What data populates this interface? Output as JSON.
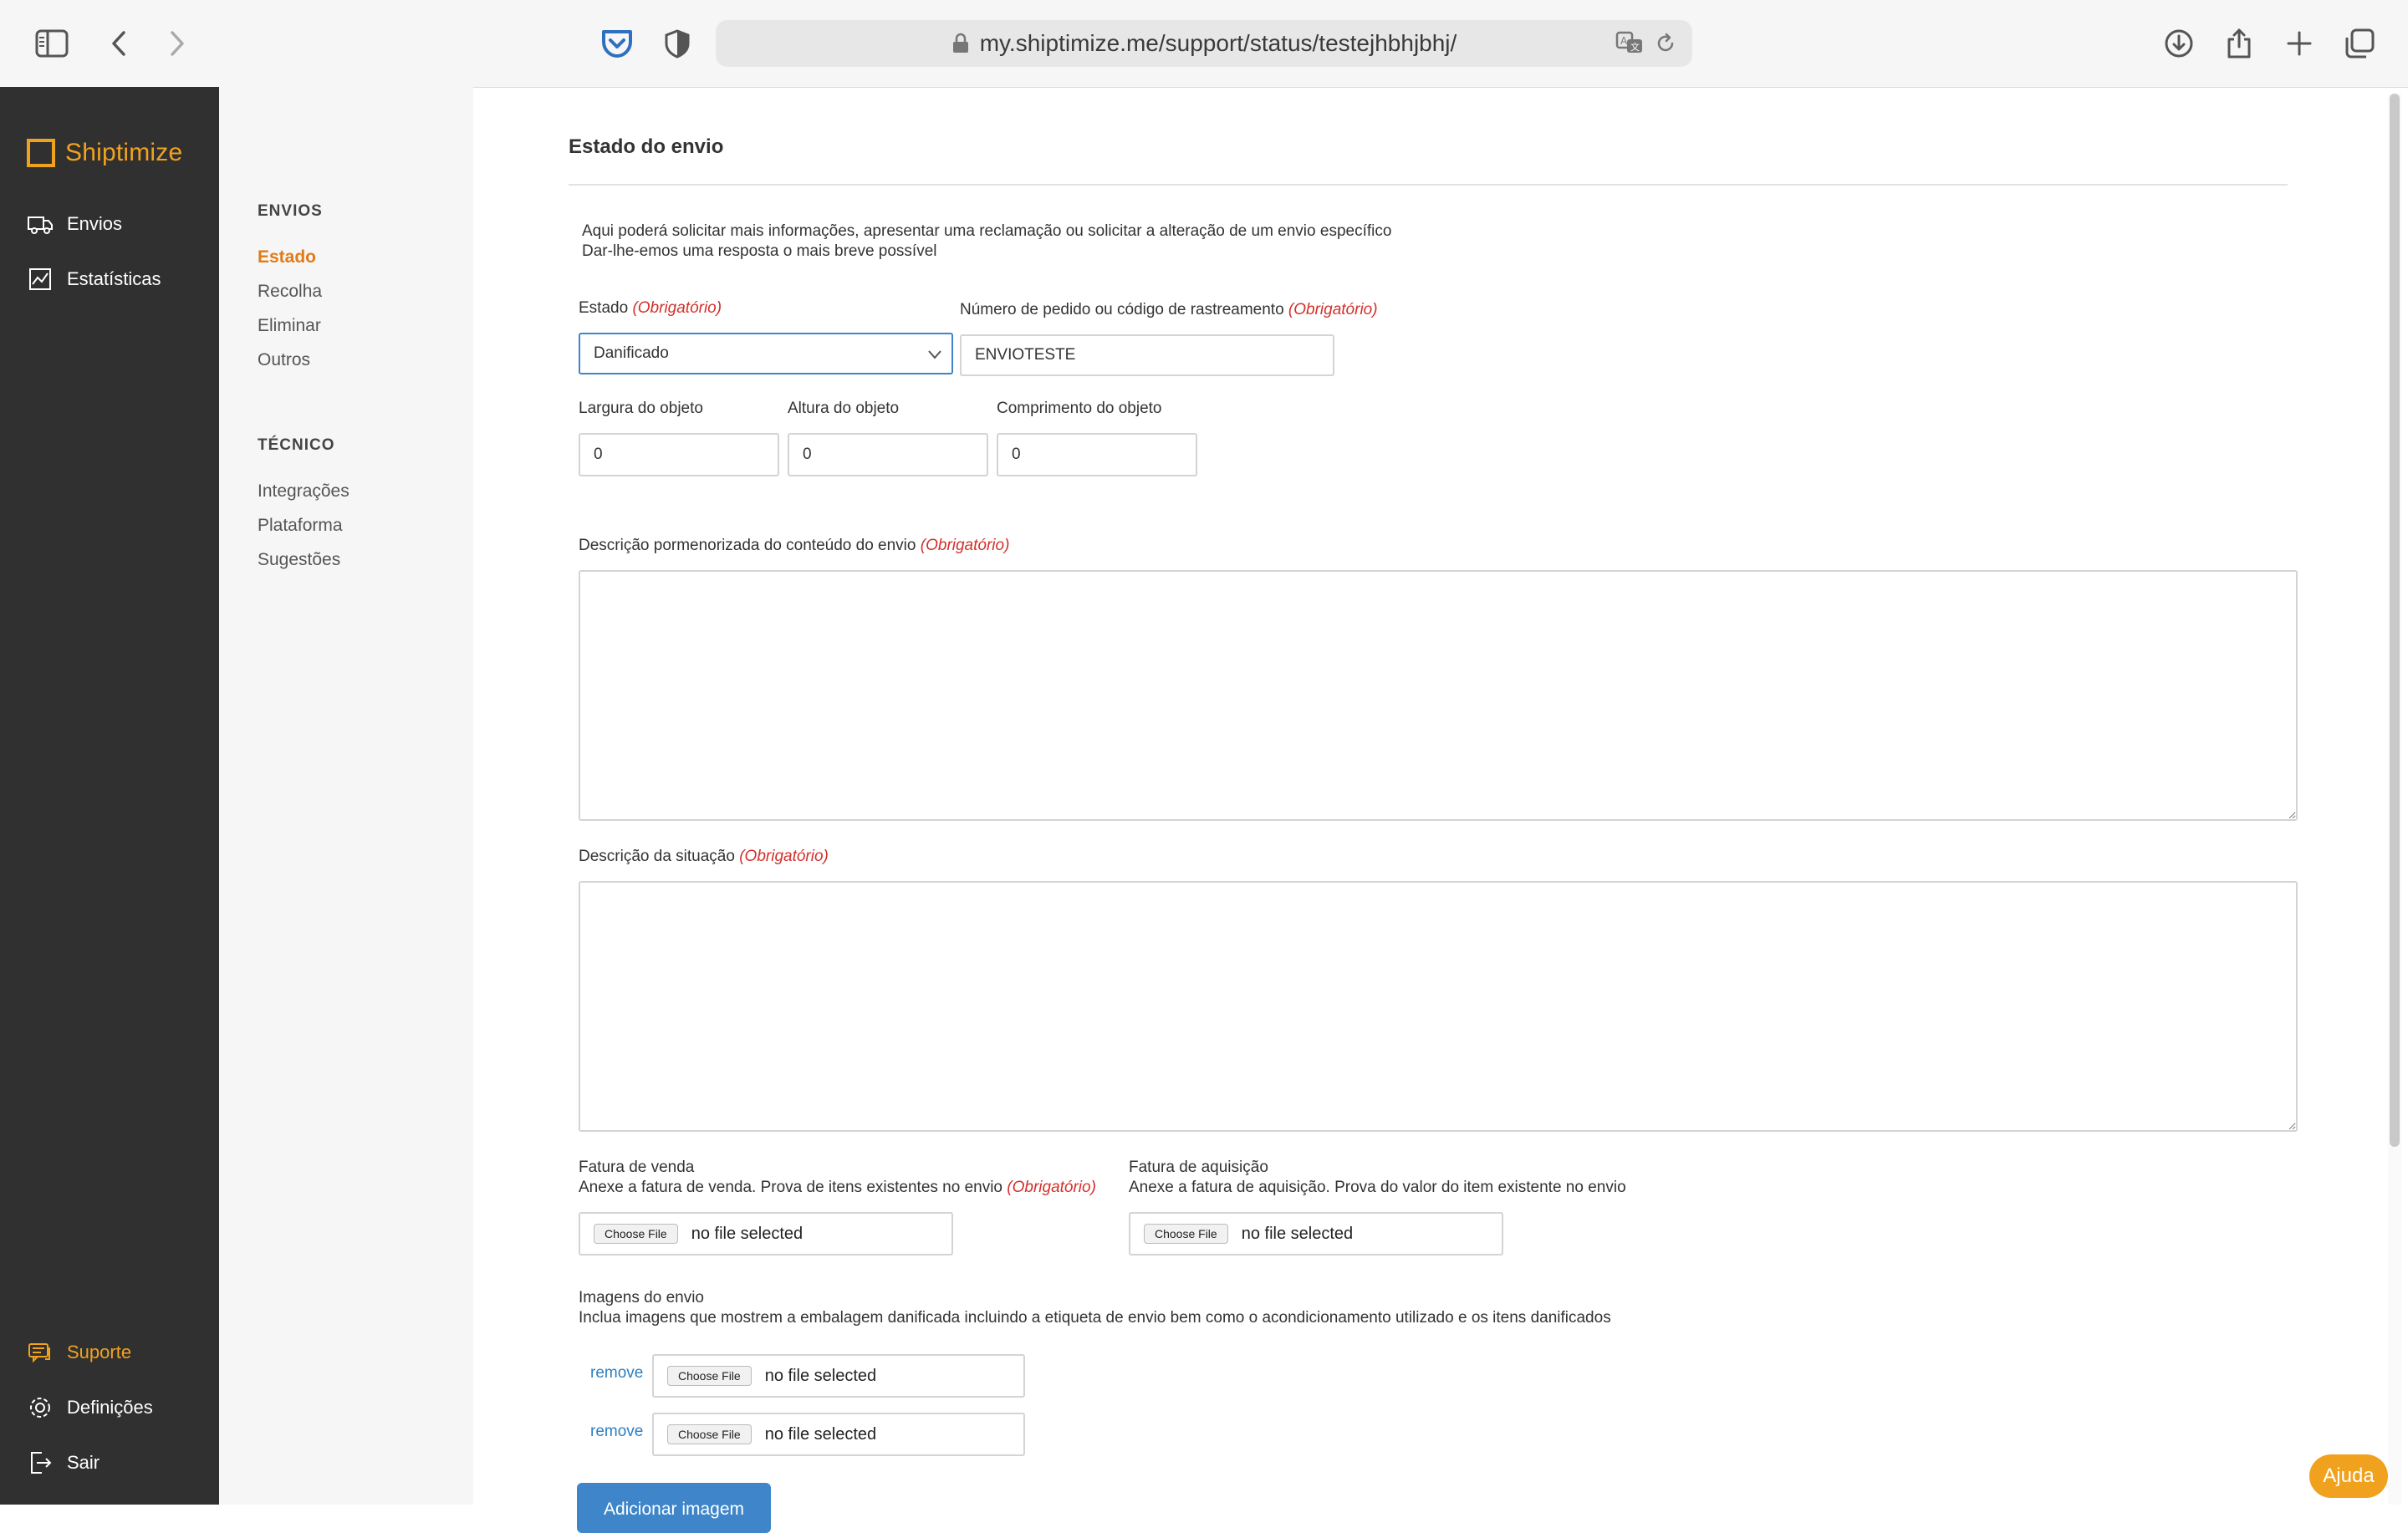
{
  "browser": {
    "url": "my.shiptimize.me/support/status/testejhbhjbhj/"
  },
  "brand": {
    "name": "Shiptimize",
    "color": "#f0a21f"
  },
  "sidebar": {
    "top": [
      {
        "label": "Envios",
        "icon": "truck-icon"
      },
      {
        "label": "Estatísticas",
        "icon": "chart-icon"
      }
    ],
    "bottom": [
      {
        "label": "Suporte",
        "icon": "support-icon"
      },
      {
        "label": "Definições",
        "icon": "gear-icon"
      },
      {
        "label": "Sair",
        "icon": "logout-icon"
      }
    ]
  },
  "subnav": {
    "section1": "ENVIOS",
    "items1": [
      "Estado",
      "Recolha",
      "Eliminar",
      "Outros"
    ],
    "section2": "TÉCNICO",
    "items2": [
      "Integrações",
      "Plataforma",
      "Sugestões"
    ]
  },
  "form": {
    "title": "Estado do envio",
    "intro1": "Aqui poderá solicitar mais informações, apresentar uma reclamação ou solicitar a alteração de um envio específico",
    "intro2": "Dar-lhe-emos uma resposta o mais breve possível",
    "required": "(Obrigatório)",
    "estado_label": "Estado",
    "estado_value": "Danificado",
    "tracking_label": "Número de pedido ou código de rastreamento",
    "tracking_value": "ENVIOTESTE",
    "width_label": "Largura do objeto",
    "width_value": "0",
    "height_label": "Altura do objeto",
    "height_value": "0",
    "length_label": "Comprimento do objeto",
    "length_value": "0",
    "desc_content_label": "Descrição pormenorizada do conteúdo do envio",
    "desc_situation_label": "Descrição da situação",
    "sale_invoice_label": "Fatura de venda",
    "sale_invoice_help": "Anexe a fatura de venda. Prova de itens existentes no envio",
    "purchase_invoice_label": "Fatura de aquisição",
    "purchase_invoice_help": "Anexe a fatura de aquisição. Prova do valor do item existente no envio",
    "images_label": "Imagens do envio",
    "images_help": "Inclua imagens que mostrem a embalagem danificada incluindo a etiqueta de envio bem como o acondicionamento utilizado e os itens danificados",
    "choose_file": "Choose File",
    "no_file": "no file selected",
    "remove": "remove",
    "add_image": "Adicionar imagem"
  },
  "help_button": "Ajuda"
}
